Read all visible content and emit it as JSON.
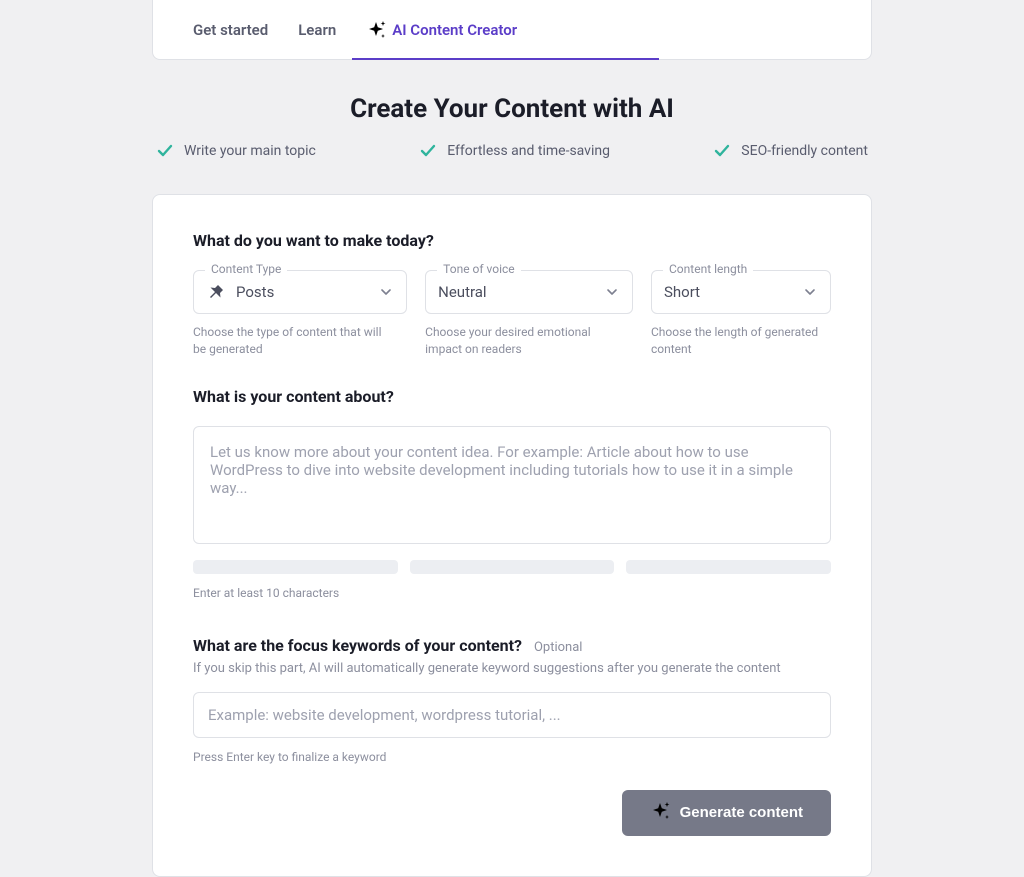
{
  "tabs": {
    "get_started": "Get started",
    "learn": "Learn",
    "ai_creator": "AI Content Creator"
  },
  "hero": {
    "title": "Create Your Content with AI",
    "benefits": [
      "Write your main topic",
      "Effortless and time-saving",
      "SEO-friendly content"
    ]
  },
  "form": {
    "heading_1": "What do you want to make today?",
    "content_type": {
      "label": "Content Type",
      "value": "Posts",
      "helper": "Choose the type of content that will be generated"
    },
    "tone": {
      "label": "Tone of voice",
      "value": "Neutral",
      "helper": "Choose your desired emotional impact on readers"
    },
    "length": {
      "label": "Content length",
      "value": "Short",
      "helper": "Choose the length of generated content"
    },
    "heading_2": "What is your content about?",
    "idea_placeholder": "Let us know more about your content idea. For example: Article about how to use WordPress to dive into website development including tutorials how to use it in a simple way...",
    "idea_min_hint": "Enter at least 10 characters",
    "heading_3": "What are the focus keywords of your content?",
    "optional": "Optional",
    "keywords_desc": "If you skip this part, AI will automatically generate keyword suggestions after you generate the content",
    "keywords_placeholder": "Example: website development, wordpress tutorial, ...",
    "keywords_hint": "Press Enter key to finalize a keyword",
    "generate_label": "Generate content"
  }
}
